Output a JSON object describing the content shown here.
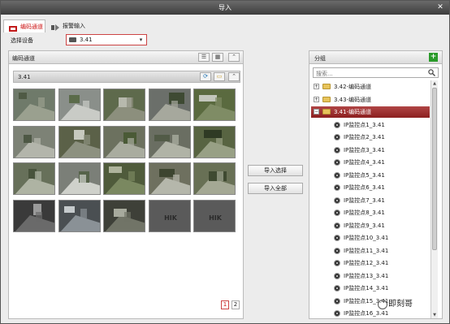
{
  "window": {
    "title": "导入",
    "close": "✕"
  },
  "tabs": [
    {
      "label": "编码通道",
      "active": true,
      "icon": "encode-channel-icon"
    },
    {
      "label": "报警输入",
      "active": false,
      "icon": "alarm-input-icon"
    }
  ],
  "device_select": {
    "label": "选择设备",
    "value": "3.41"
  },
  "left_panel": {
    "title": "编码通道",
    "group_label": "3.41",
    "thumbnail_count": 20,
    "pages": [
      "1",
      "2"
    ],
    "current_page": "1"
  },
  "middle_buttons": {
    "import_selected": "导入选择",
    "import_all": "导入全部"
  },
  "right_panel": {
    "title": "分组",
    "search_placeholder": "搜索...",
    "tree": [
      {
        "type": "group",
        "label": "3.42-编码通道",
        "expanded": false,
        "selected": false
      },
      {
        "type": "group",
        "label": "3.43-编码通道",
        "expanded": false,
        "selected": false
      },
      {
        "type": "group",
        "label": "3.41-编码通道",
        "expanded": true,
        "selected": true
      },
      {
        "type": "camera",
        "label": "IP监控点1_3.41"
      },
      {
        "type": "camera",
        "label": "IP监控点2_3.41"
      },
      {
        "type": "camera",
        "label": "IP监控点3_3.41"
      },
      {
        "type": "camera",
        "label": "IP监控点4_3.41"
      },
      {
        "type": "camera",
        "label": "IP监控点5_3.41"
      },
      {
        "type": "camera",
        "label": "IP监控点6_3.41"
      },
      {
        "type": "camera",
        "label": "IP监控点7_3.41"
      },
      {
        "type": "camera",
        "label": "IP监控点8_3.41"
      },
      {
        "type": "camera",
        "label": "IP监控点9_3.41"
      },
      {
        "type": "camera",
        "label": "IP监控点10_3.41"
      },
      {
        "type": "camera",
        "label": "IP监控点11_3.41"
      },
      {
        "type": "camera",
        "label": "IP监控点12_3.41"
      },
      {
        "type": "camera",
        "label": "IP监控点13_3.41"
      },
      {
        "type": "camera",
        "label": "IP监控点14_3.41"
      },
      {
        "type": "camera",
        "label": "IP监控点15_3.41"
      },
      {
        "type": "camera",
        "label": "IP监控点16_3.41"
      }
    ]
  },
  "watermark": "即刻哥",
  "colors": {
    "accent": "#c11a1a",
    "selected_row": "#8c1f1f",
    "add": "#2a9a2a"
  }
}
